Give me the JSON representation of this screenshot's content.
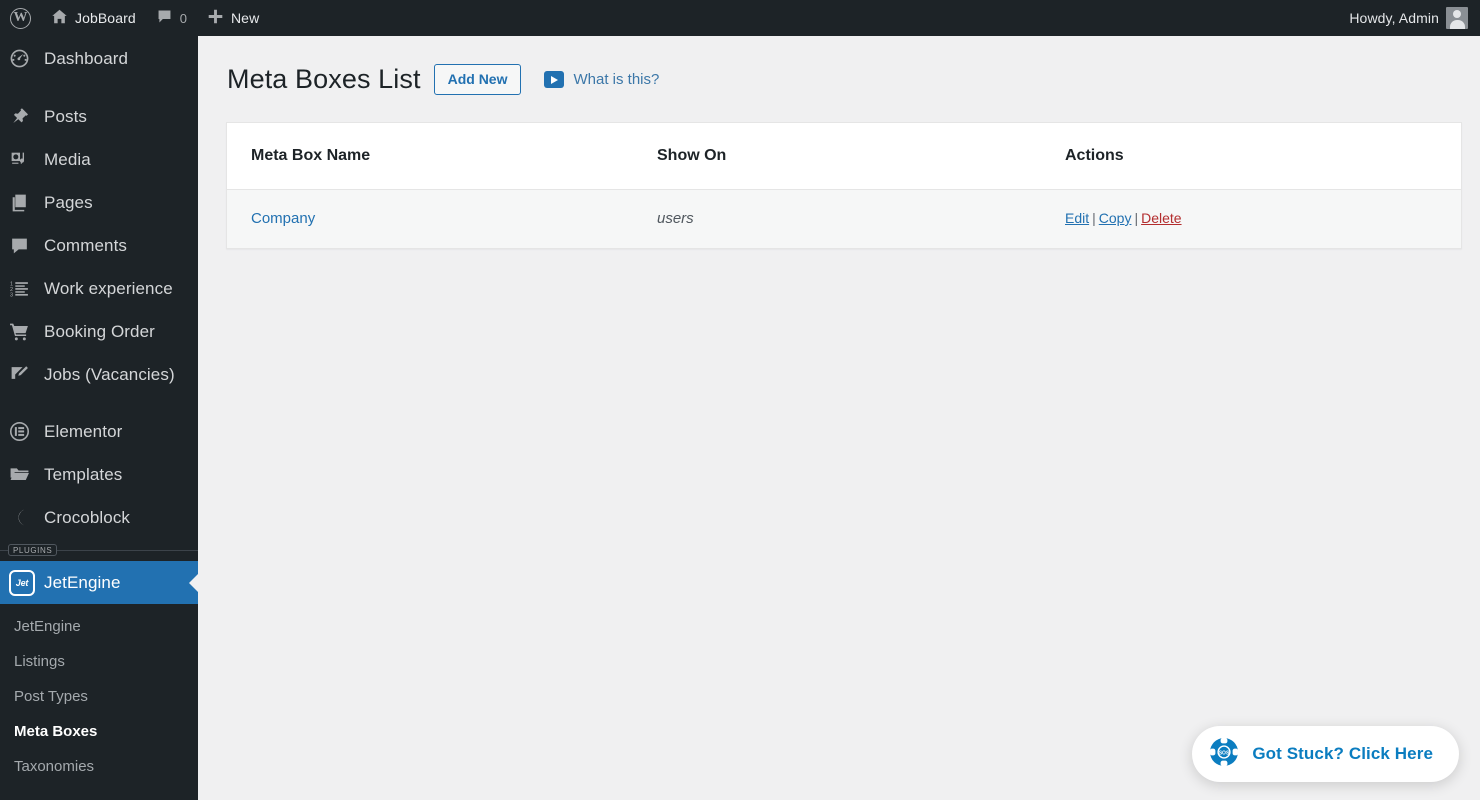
{
  "adminbar": {
    "wp_logo": "wordpress-logo",
    "site_name": "JobBoard",
    "comments_count": "0",
    "new_label": "New",
    "howdy": "Howdy, Admin"
  },
  "sidebar": {
    "items": [
      {
        "label": "Dashboard",
        "icon": "dashboard-icon"
      },
      {
        "label": "Posts",
        "icon": "pin-icon"
      },
      {
        "label": "Media",
        "icon": "media-icon"
      },
      {
        "label": "Pages",
        "icon": "pages-icon"
      },
      {
        "label": "Comments",
        "icon": "comments-icon"
      },
      {
        "label": "Work experience",
        "icon": "ordered-list-icon"
      },
      {
        "label": "Booking Order",
        "icon": "cart-icon"
      },
      {
        "label": "Jobs (Vacancies)",
        "icon": "edit-page-icon"
      },
      {
        "label": "Elementor",
        "icon": "elementor-icon"
      },
      {
        "label": "Templates",
        "icon": "folder-icon"
      },
      {
        "label": "Crocoblock",
        "icon": "crocoblock-icon"
      }
    ],
    "separator_label": "PLUGINS",
    "plugin_item": {
      "label": "JetEngine",
      "icon": "jetengine-icon",
      "badge_text": "Jet"
    },
    "submenu": [
      {
        "label": "JetEngine",
        "current": false
      },
      {
        "label": "Listings",
        "current": false
      },
      {
        "label": "Post Types",
        "current": false
      },
      {
        "label": "Meta Boxes",
        "current": true
      },
      {
        "label": "Taxonomies",
        "current": false
      }
    ]
  },
  "page": {
    "title": "Meta Boxes List",
    "add_new_label": "Add New",
    "what_is_this_label": "What is this?",
    "play_icon": "play-icon"
  },
  "table": {
    "headers": [
      "Meta Box Name",
      "Show On",
      "Actions"
    ],
    "rows": [
      {
        "name": "Company",
        "show_on": "users",
        "actions": {
          "edit": "Edit",
          "copy": "Copy",
          "delete": "Delete",
          "separator": "|"
        }
      }
    ]
  },
  "support": {
    "label": "Got Stuck? Click Here",
    "icon": "lifebuoy-sos-icon"
  },
  "colors": {
    "admin_dark": "#1d2327",
    "accent_blue": "#2271b1",
    "delete_red": "#b32d2e",
    "support_blue": "#0b7dc0",
    "page_bg": "#f0f0f1",
    "row_bg": "#f6f7f7"
  }
}
